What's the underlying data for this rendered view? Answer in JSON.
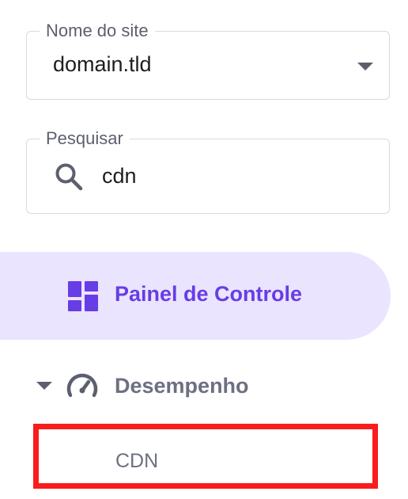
{
  "site_selector": {
    "label": "Nome do site",
    "value": "domain.tld",
    "icon": "chevron-down-icon"
  },
  "search": {
    "label": "Pesquisar",
    "value": "cdn",
    "icon": "search-icon"
  },
  "nav": {
    "dashboard": {
      "label": "Painel de Controle",
      "icon": "grid-icon",
      "active": true
    },
    "performance": {
      "label": "Desempenho",
      "icon": "gauge-icon",
      "expanded": true
    },
    "cdn": {
      "label": "CDN",
      "highlighted": true
    }
  },
  "colors": {
    "accent": "#673de6",
    "active_bg": "#ebe4ff",
    "highlight_border": "#fa1c1c",
    "muted_text": "#6d7081"
  }
}
